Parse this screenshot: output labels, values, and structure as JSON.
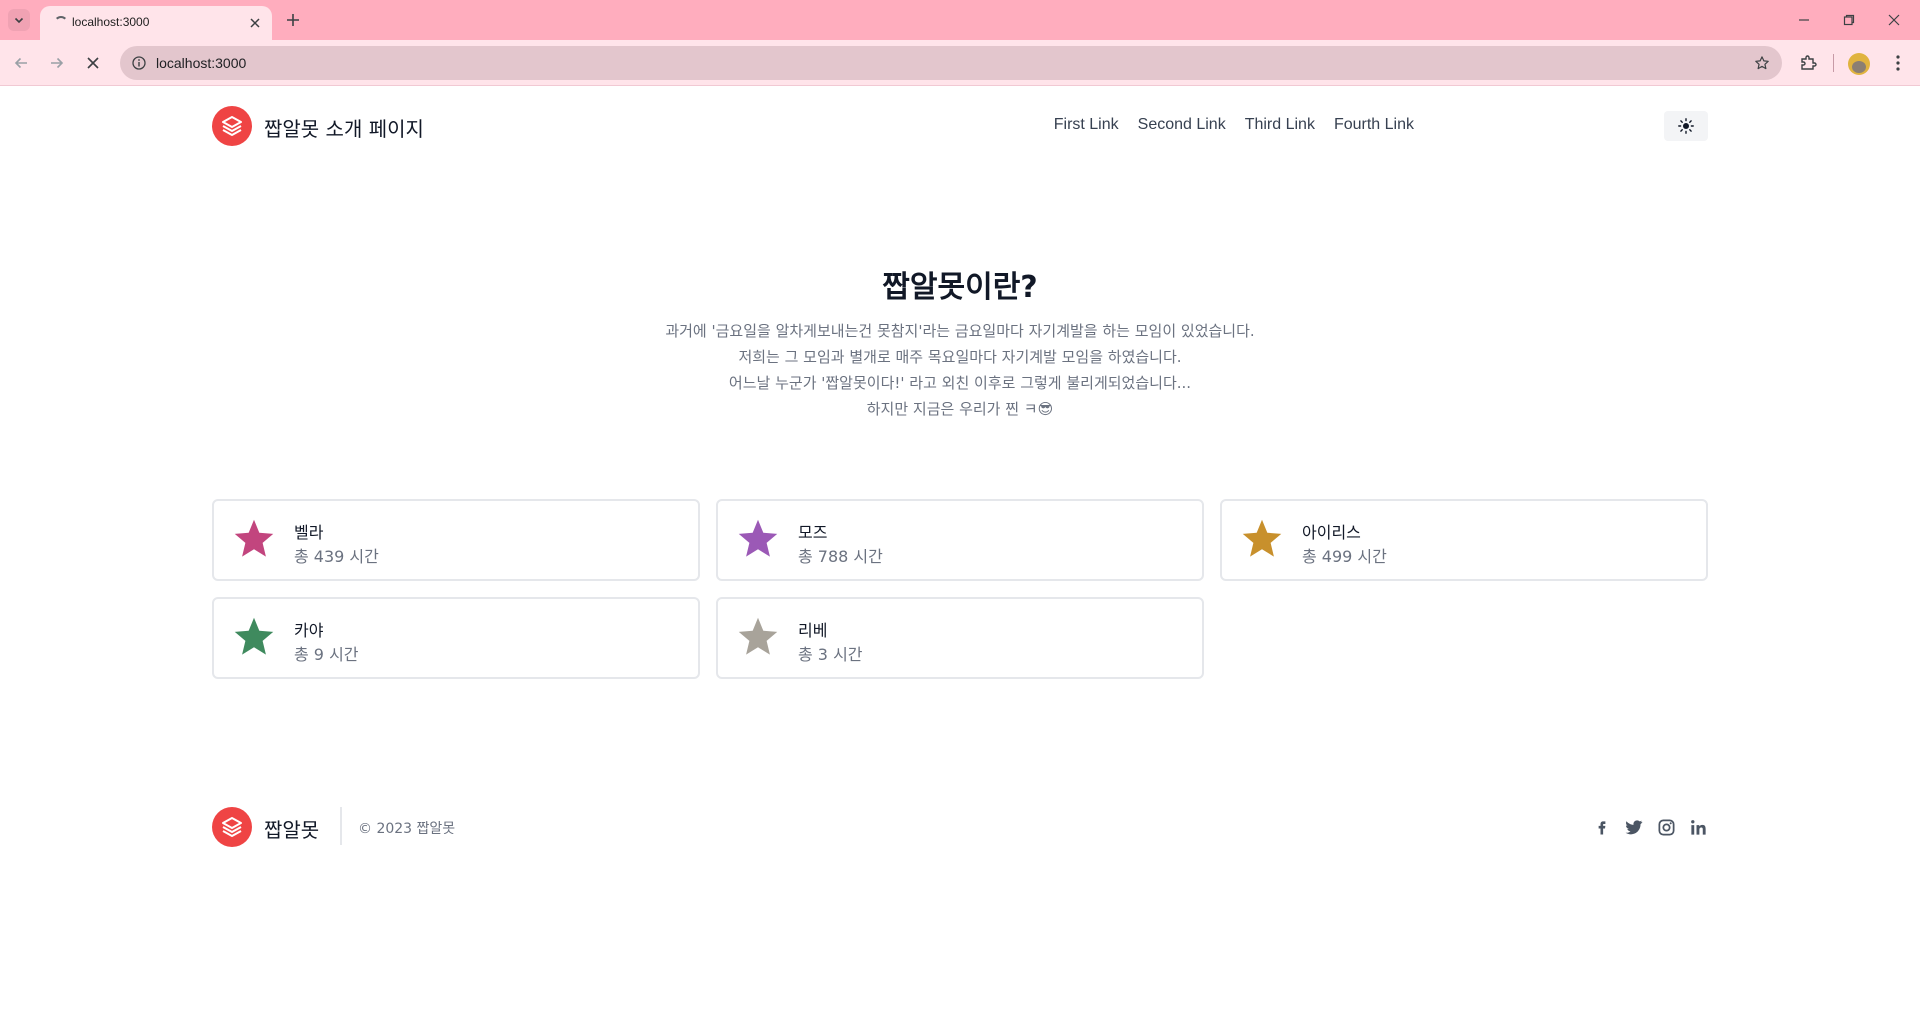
{
  "browser": {
    "tab_title": "localhost:3000",
    "url": "localhost:3000"
  },
  "header": {
    "title": "짭알못 소개 페이지",
    "nav_links": [
      "First Link",
      "Second Link",
      "Third Link",
      "Fourth Link"
    ]
  },
  "hero": {
    "title": "짭알못이란?",
    "lines": [
      "과거에 '금요일을 알차게보내는건 못참지'라는 금요일마다 자기계발을 하는 모임이 있었습니다.",
      "저희는 그 모임과 별개로 매주 목요일마다 자기계발 모임을 하였습니다.",
      "어느날 누군가 '짭알못이다!' 라고 외친 이후로 그렇게 불리게되었습니다...",
      "하지만 지금은 우리가 찐 ㅋ😎"
    ]
  },
  "members": [
    {
      "name": "벨라",
      "time": "총 439 시간",
      "star_color": "#c2457e"
    },
    {
      "name": "모즈",
      "time": "총 788 시간",
      "star_color": "#9b59b6"
    },
    {
      "name": "아이리스",
      "time": "총 499 시간",
      "star_color": "#c8902c"
    },
    {
      "name": "카야",
      "time": "총 9 시간",
      "star_color": "#3f8a5e"
    },
    {
      "name": "리베",
      "time": "총 3 시간",
      "star_color": "#a8a39a"
    }
  ],
  "footer": {
    "brand": "짭알못",
    "copyright": "© 2023 짭알못"
  },
  "colors": {
    "accent": "#ef4444",
    "chrome_tabbar": "#ffadbe",
    "chrome_toolbar": "#ffe4ea"
  }
}
